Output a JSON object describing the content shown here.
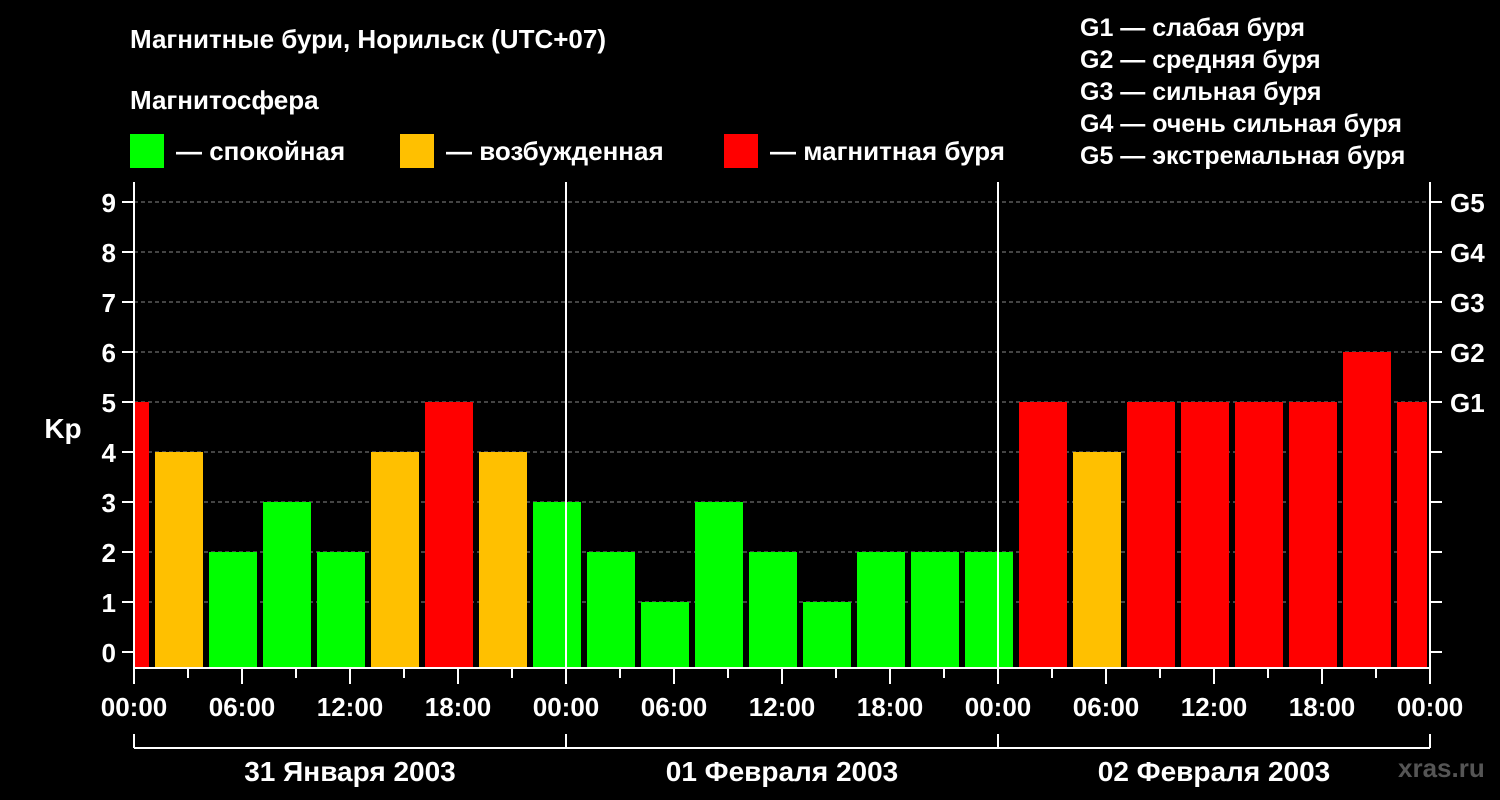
{
  "header": {
    "title": "Магнитные бури, Норильск (UTC+07)",
    "subtitle": "Магнитосфера"
  },
  "legend": [
    {
      "label": "— спокойная",
      "color": "#00ff00"
    },
    {
      "label": "— возбужденная",
      "color": "#ffc000"
    },
    {
      "label": "— магнитная буря",
      "color": "#ff0000"
    }
  ],
  "storm_scale": [
    "G1 — слабая буря",
    "G2 — средняя буря",
    "G3 — сильная буря",
    "G4 — очень сильная буря",
    "G5 — экстремальная буря"
  ],
  "watermark": "xras.ru",
  "chart_data": {
    "type": "bar",
    "ylabel": "Kp",
    "ylim": [
      0,
      9
    ],
    "yticks": [
      "0",
      "1",
      "2",
      "3",
      "4",
      "5",
      "6",
      "7",
      "8",
      "9"
    ],
    "right_ticks": [
      {
        "value": 5,
        "label": "G1"
      },
      {
        "value": 6,
        "label": "G2"
      },
      {
        "value": 7,
        "label": "G3"
      },
      {
        "value": 8,
        "label": "G4"
      },
      {
        "value": 9,
        "label": "G5"
      }
    ],
    "grid": "horizontal dashed",
    "x_hour_range": [
      0,
      72
    ],
    "xtick_hours": [
      0,
      6,
      12,
      18,
      24,
      30,
      36,
      42,
      48,
      54,
      60,
      66,
      72
    ],
    "xtick_labels": [
      "00:00",
      "06:00",
      "12:00",
      "18:00",
      "00:00",
      "06:00",
      "12:00",
      "18:00",
      "00:00",
      "06:00",
      "12:00",
      "18:00",
      "00:00"
    ],
    "days": [
      "31 Января 2003",
      "01 Февраля 2003",
      "02 Февраля 2003"
    ],
    "colors": {
      "quiet": "#00ff00",
      "active": "#ffc000",
      "storm": "#ff0000"
    },
    "bars": [
      {
        "start": "00:00",
        "end": "01:00",
        "kp": 5
      },
      {
        "start": "01:00",
        "end": "04:00",
        "kp": 4
      },
      {
        "start": "04:00",
        "end": "07:00",
        "kp": 2
      },
      {
        "start": "07:00",
        "end": "10:00",
        "kp": 3
      },
      {
        "start": "10:00",
        "end": "13:00",
        "kp": 2
      },
      {
        "start": "13:00",
        "end": "16:00",
        "kp": 4
      },
      {
        "start": "16:00",
        "end": "19:00",
        "kp": 5
      },
      {
        "start": "19:00",
        "end": "22:00",
        "kp": 4
      },
      {
        "start": "22:00",
        "end": "01:00",
        "kp": 3
      },
      {
        "start": "01:00",
        "end": "04:00",
        "kp": 2
      },
      {
        "start": "04:00",
        "end": "07:00",
        "kp": 1
      },
      {
        "start": "07:00",
        "end": "10:00",
        "kp": 3
      },
      {
        "start": "10:00",
        "end": "13:00",
        "kp": 2
      },
      {
        "start": "13:00",
        "end": "16:00",
        "kp": 1
      },
      {
        "start": "16:00",
        "end": "19:00",
        "kp": 2
      },
      {
        "start": "19:00",
        "end": "22:00",
        "kp": 2
      },
      {
        "start": "22:00",
        "end": "01:00",
        "kp": 2
      },
      {
        "start": "01:00",
        "end": "04:00",
        "kp": 5
      },
      {
        "start": "04:00",
        "end": "07:00",
        "kp": 4
      },
      {
        "start": "07:00",
        "end": "10:00",
        "kp": 5
      },
      {
        "start": "10:00",
        "end": "13:00",
        "kp": 5
      },
      {
        "start": "13:00",
        "end": "16:00",
        "kp": 5
      },
      {
        "start": "16:00",
        "end": "19:00",
        "kp": 5
      },
      {
        "start": "19:00",
        "end": "22:00",
        "kp": 6
      },
      {
        "start": "22:00",
        "end": "00:00",
        "kp": 5
      }
    ]
  }
}
